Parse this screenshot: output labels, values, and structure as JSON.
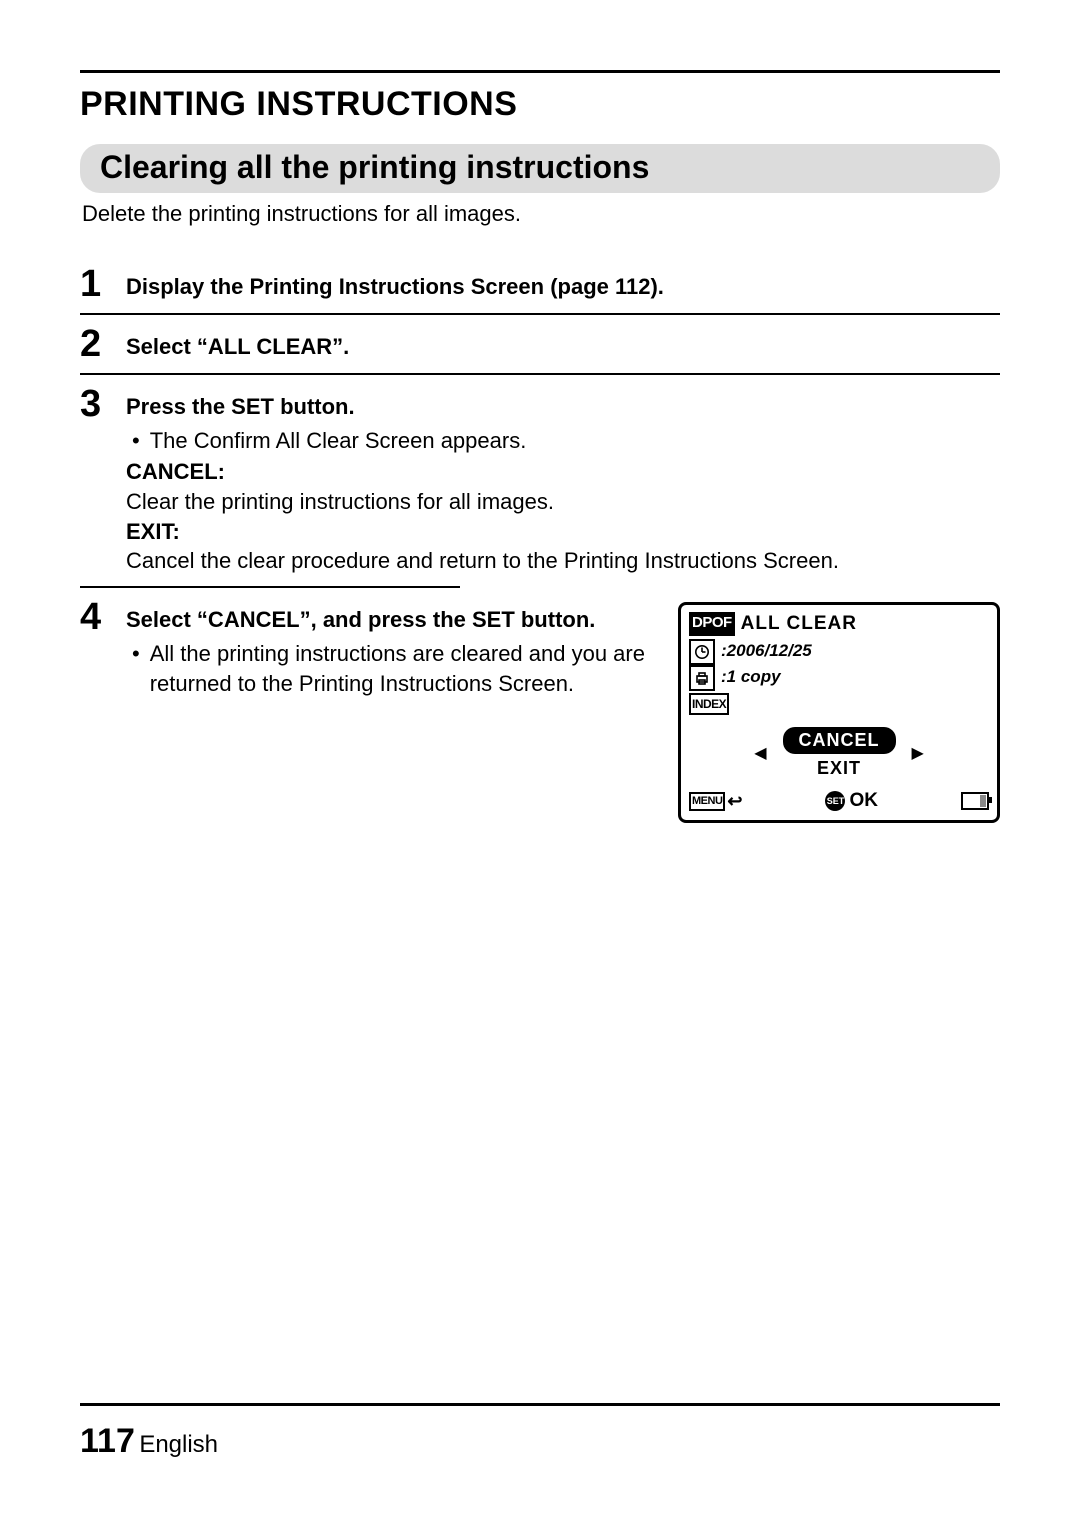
{
  "header": {
    "title": "PRINTING INSTRUCTIONS",
    "subtitle": "Clearing all the printing instructions",
    "intro": "Delete the printing instructions for all images."
  },
  "steps": [
    {
      "num": "1",
      "head": "Display the Printing Instructions Screen (page 112)."
    },
    {
      "num": "2",
      "head": "Select “ALL CLEAR”."
    },
    {
      "num": "3",
      "head": "Press the SET button.",
      "bullet": "The Confirm All Clear Screen appears.",
      "defs": [
        {
          "term": "CANCEL:",
          "desc": "Clear the printing instructions for all images."
        },
        {
          "term": "EXIT:",
          "desc": "Cancel the clear procedure and return to the Printing Instructions Screen."
        }
      ]
    },
    {
      "num": "4",
      "head": "Select “CANCEL”, and press the SET button.",
      "bullet": "All the printing instructions are cleared and you are returned to the Printing Instructions Screen."
    }
  ],
  "lcd": {
    "dpof": "DPOF",
    "title": "ALL CLEAR",
    "date_prefix": ":",
    "date": "2006/12/25",
    "copies_prefix": ":",
    "copies": "1 copy",
    "index": "INDEX",
    "option_selected": "CANCEL",
    "option_other": "EXIT",
    "arrow_left": "◀",
    "arrow_right": "▶",
    "menu": "MENU",
    "back_arrow": "↩",
    "set": "SET",
    "ok": "OK"
  },
  "footer": {
    "page": "117",
    "language": "English"
  }
}
